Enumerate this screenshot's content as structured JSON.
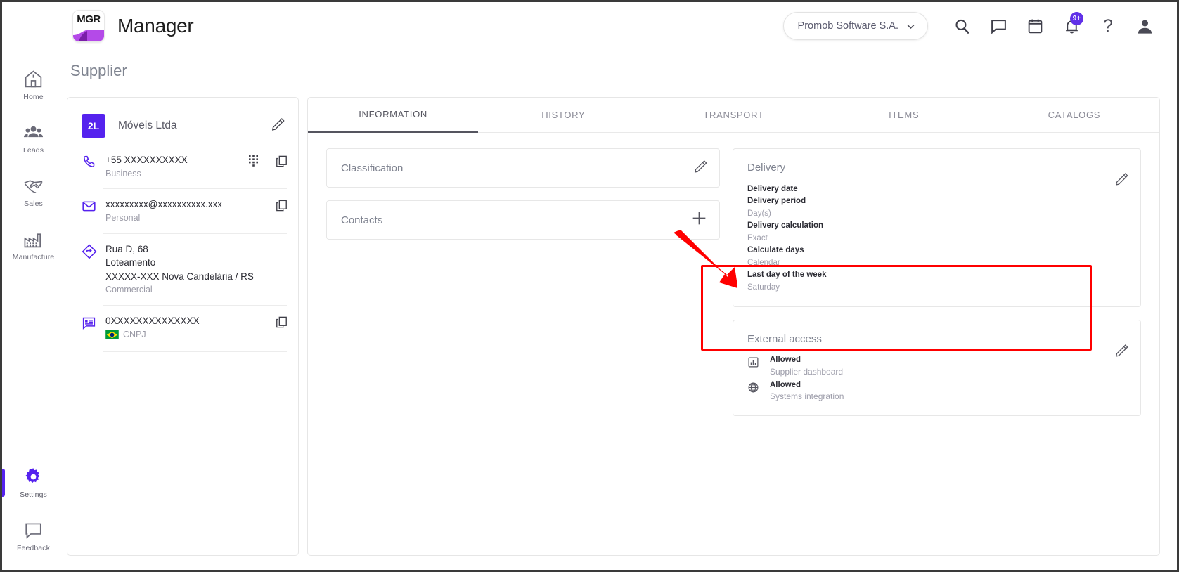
{
  "app": {
    "logo_text": "MGR",
    "brand_name": "Manager",
    "accent_color": "#5522ee",
    "annotation_color": "#ff0000"
  },
  "header": {
    "org": "Promob Software S.A.",
    "chevron": "chevron-down-icon",
    "notification_badge": "9+",
    "help_glyph": "?",
    "icons": [
      "search-icon",
      "chat-icon",
      "calendar-icon",
      "bell-icon",
      "help-icon",
      "account-icon"
    ]
  },
  "sidebar": {
    "items": [
      {
        "label": "Home",
        "icon": "home-icon",
        "active": false
      },
      {
        "label": "Leads",
        "icon": "people-icon",
        "active": false
      },
      {
        "label": "Sales",
        "icon": "handshake-icon",
        "active": false
      },
      {
        "label": "Manufacture",
        "icon": "factory-icon",
        "active": false
      }
    ],
    "bottom_items": [
      {
        "label": "Settings",
        "icon": "gear-icon",
        "active": true
      },
      {
        "label": "Feedback",
        "icon": "chat-bubble-icon",
        "active": false
      }
    ]
  },
  "page": {
    "title": "Supplier"
  },
  "supplier": {
    "initials": "2L",
    "name": "Móveis Ltda",
    "edit_action": "edit-icon",
    "rows": [
      {
        "icon": "phone-icon",
        "primary": "+55 XXXXXXXXXX",
        "secondary": "Business",
        "actions": [
          "dialpad-icon",
          "copy-icon"
        ]
      },
      {
        "icon": "email-icon",
        "primary": "xxxxxxxxx@xxxxxxxxxx.xxx",
        "secondary": "Personal",
        "actions": [
          "copy-icon"
        ]
      },
      {
        "icon": "address-icon",
        "primary_lines": [
          "Rua D, 68",
          "Loteamento",
          "XXXXX-XXX Nova Candelária / RS"
        ],
        "secondary": "Commercial",
        "actions": []
      },
      {
        "icon": "document-icon",
        "primary": "0XXXXXXXXXXXXXX",
        "secondary": "CNPJ",
        "flag": "brazil-flag-icon",
        "actions": [
          "copy-icon"
        ]
      }
    ]
  },
  "tabs": [
    {
      "label": "INFORMATION",
      "active": true
    },
    {
      "label": "HISTORY",
      "active": false
    },
    {
      "label": "TRANSPORT",
      "active": false
    },
    {
      "label": "ITEMS",
      "active": false
    },
    {
      "label": "CATALOGS",
      "active": false
    }
  ],
  "information": {
    "classification": {
      "title": "Classification",
      "action": "edit-icon"
    },
    "contacts": {
      "title": "Contacts",
      "action": "add-icon"
    },
    "delivery": {
      "title": "Delivery",
      "action": "edit-icon",
      "fields": [
        {
          "label": "Delivery date",
          "value": null
        },
        {
          "label": "Delivery period",
          "value": "Day(s)"
        },
        {
          "label": "Delivery calculation",
          "value": "Exact"
        },
        {
          "label": "Calculate days",
          "value": "Calendar"
        },
        {
          "label": "Last day of the week",
          "value": "Saturday"
        }
      ]
    },
    "external_access": {
      "title": "External access",
      "action": "edit-icon",
      "items": [
        {
          "icon": "chart-icon",
          "status": "Allowed",
          "description": "Supplier dashboard"
        },
        {
          "icon": "globe-icon",
          "status": "Allowed",
          "description": "Systems integration"
        }
      ]
    }
  }
}
